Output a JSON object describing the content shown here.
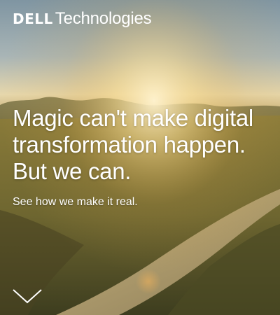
{
  "brand": {
    "logo_dell": "DELL",
    "logo_technologies": "Technologies"
  },
  "hero": {
    "headline_lines": [
      "Magic can't make digital",
      "transformation happen.",
      "But we can."
    ],
    "cta_text": "See how we make it real."
  },
  "icons": {
    "scroll_down": "chevron-down-icon"
  },
  "colors": {
    "text": "#ffffff",
    "sky": "#8fa3ad",
    "sun_glow": "#f6d48a",
    "field_shadow": "#3b3f24"
  }
}
